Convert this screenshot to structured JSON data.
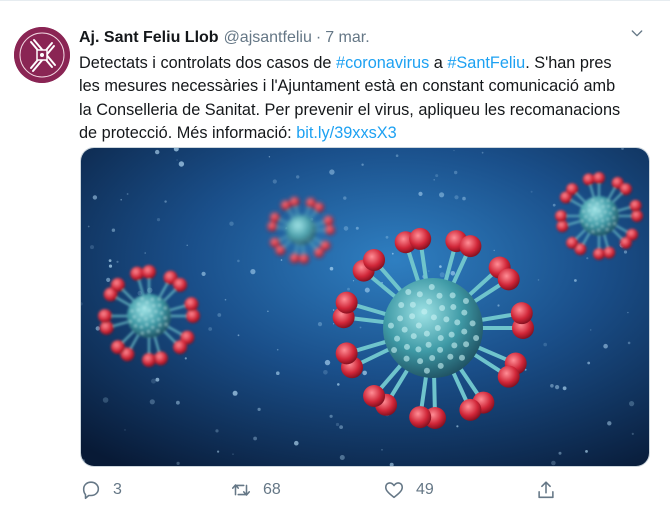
{
  "tweet": {
    "display_name": "Aj. Sant Feliu Llob",
    "handle": "@ajsantfeliu",
    "separator": "·",
    "date": "7 mar.",
    "text": {
      "line1_a": "Detectats i controlats dos casos de ",
      "hashtag1": "#coronavirus",
      "line1_b": " a ",
      "hashtag2": "#SantFeliu",
      "line1_c": ". S'han pres",
      "line2": "les mesures necessàries i l'Ajuntament està en constant comunicació amb",
      "line3": "la Conselleria de Sanitat. Per prevenir el virus, apliqueu les recomanacions",
      "line4_a": "de protecció. Més informació: ",
      "link": "bit.ly/39xxsX3"
    }
  },
  "actions": {
    "reply": {
      "icon": "reply-icon",
      "count": "3"
    },
    "retweet": {
      "icon": "retweet-icon",
      "count": "68"
    },
    "like": {
      "icon": "heart-icon",
      "count": "49"
    },
    "share": {
      "icon": "share-icon"
    }
  },
  "colors": {
    "link": "#1da1f2",
    "secondary_text": "#657786",
    "avatar_bg": "#8a2554",
    "border": "#e6ecf0"
  },
  "icons": {
    "menu": "chevron-down-icon",
    "avatar": "municipal-logo-icon",
    "media": "coronavirus-illustration"
  }
}
